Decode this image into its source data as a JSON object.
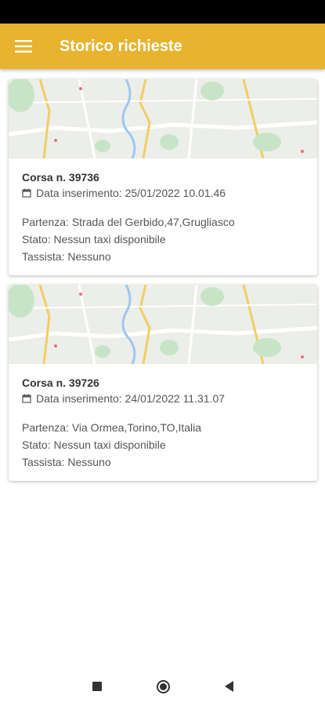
{
  "app_bar": {
    "title": "Storico richieste",
    "menu_icon": "hamburger-menu-icon",
    "background_color": "#e8b32e"
  },
  "requests": [
    {
      "title": "Corsa n. 39736",
      "date": "Data inserimento: 25/01/2022 10.01.46",
      "departure": "Partenza: Strada del Gerbido,47,Grugliasco",
      "status": "Stato: Nessun taxi disponibile",
      "driver": "Tassista: Nessuno"
    },
    {
      "title": "Corsa n. 39726",
      "date": "Data inserimento: 24/01/2022 11.31.07",
      "departure": "Partenza: Via Ormea,Torino,TO,Italia",
      "status": "Stato: Nessun taxi disponibile",
      "driver": "Tassista: Nessuno"
    }
  ],
  "icons": {
    "calendar": "calendar-icon",
    "map": "map-thumbnail"
  },
  "nav": {
    "recents": "recents-square-icon",
    "home": "home-circle-icon",
    "back": "back-triangle-icon"
  }
}
